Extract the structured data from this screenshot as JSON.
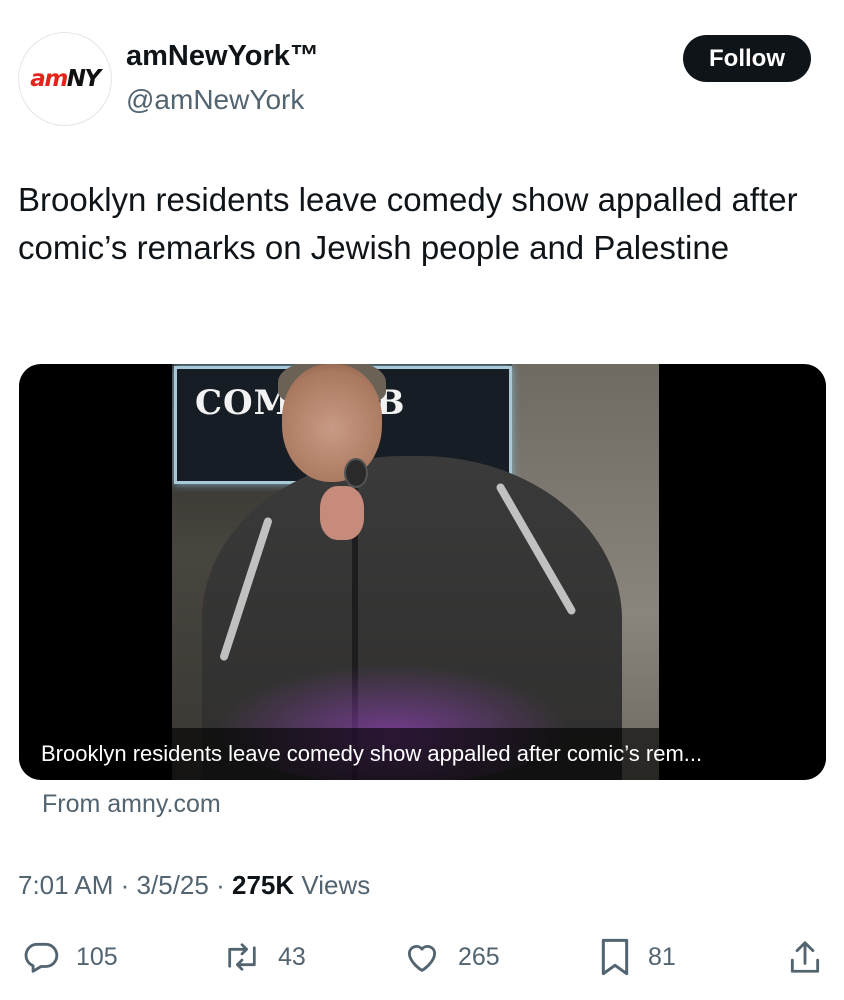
{
  "account": {
    "logo_am": "am",
    "logo_ny": "NY",
    "display_name": "amNewYork™",
    "handle": "@amNewYork",
    "follow_label": "Follow"
  },
  "tweet": {
    "text": "Brooklyn residents leave comedy show appalled after comic’s remarks on Jewish people and Palestine"
  },
  "media": {
    "sign_text": "COMI    LUB",
    "caption": "Brooklyn residents leave comedy show appalled after comic’s rem...",
    "source": "From amny.com"
  },
  "meta": {
    "time": "7:01 AM",
    "date": "3/5/25",
    "separator": "·",
    "views_count": "275K",
    "views_label": "Views"
  },
  "actions": {
    "reply": {
      "icon": "reply-icon",
      "count": "105"
    },
    "repost": {
      "icon": "repost-icon",
      "count": "43"
    },
    "like": {
      "icon": "heart-icon",
      "count": "265"
    },
    "bookmark": {
      "icon": "bookmark-icon",
      "count": "81"
    },
    "share": {
      "icon": "share-icon"
    }
  },
  "colors": {
    "text_primary": "#0f1419",
    "text_secondary": "#536471",
    "brand_red": "#e1251b",
    "follow_bg": "#0f1419"
  }
}
